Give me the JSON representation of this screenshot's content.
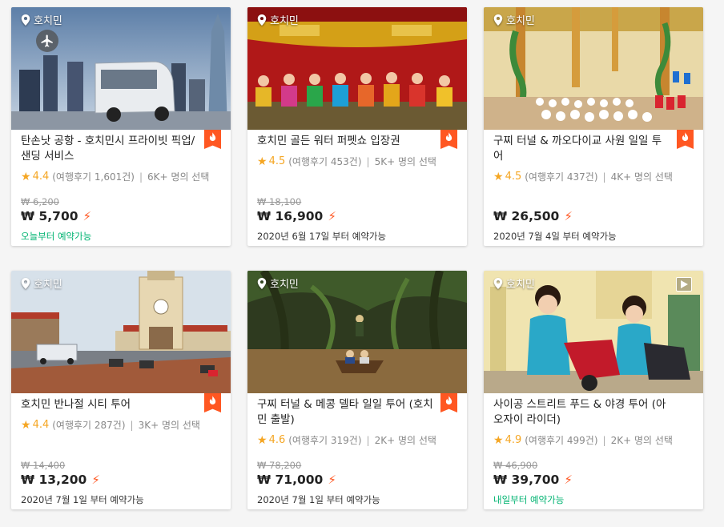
{
  "cards": [
    {
      "location": "호치민",
      "title": "탄손낫 공항 - 호치민시 프라이빗 픽업/샌딩 서비스",
      "score": "4.4",
      "reviews": "(여행후기 1,601건)",
      "booked": "6K+ 명의 선택",
      "orig_price": "₩ 6,200",
      "price": "₩ 5,700",
      "avail": "오늘부터 예약가능",
      "icon": "airplane-icon"
    },
    {
      "location": "호치민",
      "title": "호치민 골든 워터 퍼펫쇼 입장권",
      "score": "4.5",
      "reviews": "(여행후기 453건)",
      "booked": "5K+ 명의 선택",
      "orig_price": "₩ 18,100",
      "price": "₩ 16,900",
      "avail": "2020년 6월 17일 부터 예약가능"
    },
    {
      "location": "호치민",
      "title": "구찌 터널 & 까오다이교 사원 일일 투어",
      "score": "4.5",
      "reviews": "(여행후기 437건)",
      "booked": "4K+ 명의 선택",
      "orig_price": "",
      "price": "₩ 26,500",
      "avail": "2020년 7월 4일 부터 예약가능"
    },
    {
      "location": "호치민",
      "title": "호치민 반나절 시티 투어",
      "score": "4.4",
      "reviews": "(여행후기 287건)",
      "booked": "3K+ 명의 선택",
      "orig_price": "₩ 14,400",
      "price": "₩ 13,200",
      "avail": "2020년 7월 1일 부터 예약가능"
    },
    {
      "location": "호치민",
      "title": "구찌 터널 & 메콩 델타 일일 투어 (호치민 출발)",
      "score": "4.6",
      "reviews": "(여행후기 319건)",
      "booked": "2K+ 명의 선택",
      "orig_price": "₩ 78,200",
      "price": "₩ 71,000",
      "avail": "2020년 7월 1일 부터 예약가능"
    },
    {
      "location": "호치민",
      "title": "사이공 스트리트 푸드 & 야경 투어 (아오자이 라이더)",
      "score": "4.9",
      "reviews": "(여행후기 499건)",
      "booked": "2K+ 명의 선택",
      "orig_price": "₩ 46,900",
      "price": "₩ 39,700",
      "avail": "내일부터 예약가능",
      "icon": "video-icon"
    }
  ],
  "colors": {
    "accent": "#ff5722",
    "star": "#f5a623",
    "available_green": "#00b371"
  }
}
